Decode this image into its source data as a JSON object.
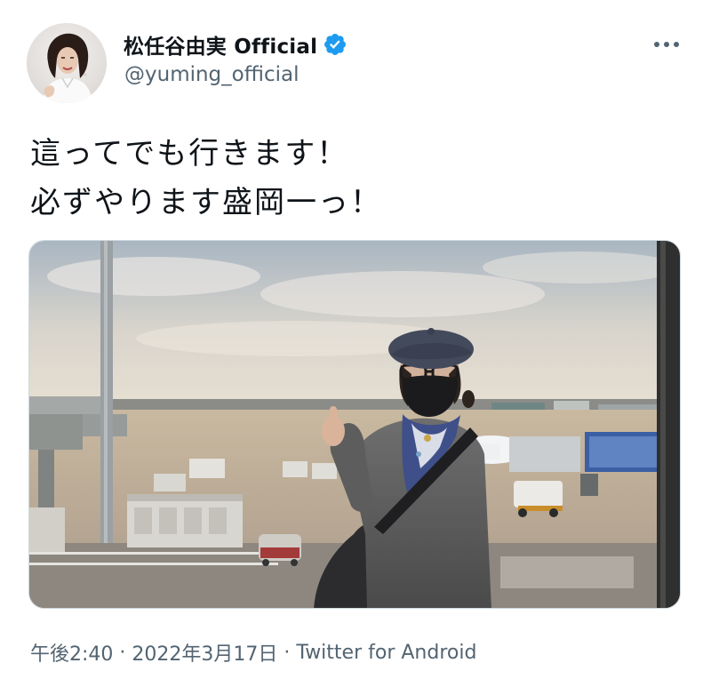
{
  "author": {
    "display_name": "松任谷由実 Official",
    "handle": "@yuming_official",
    "verified": true
  },
  "tweet": {
    "lines": [
      "這ってでも行きます！",
      "必ずやります盛岡一っ！"
    ]
  },
  "meta": {
    "time": "午後2:40",
    "date": "2022年3月17日",
    "separator": "·",
    "source": "Twitter for Android"
  },
  "icons": {
    "verified": "verified-badge-icon",
    "more": "more-options-icon"
  },
  "colors": {
    "verified_blue": "#1d9bf0",
    "secondary_text": "#536471",
    "primary_text": "#0f1419"
  }
}
